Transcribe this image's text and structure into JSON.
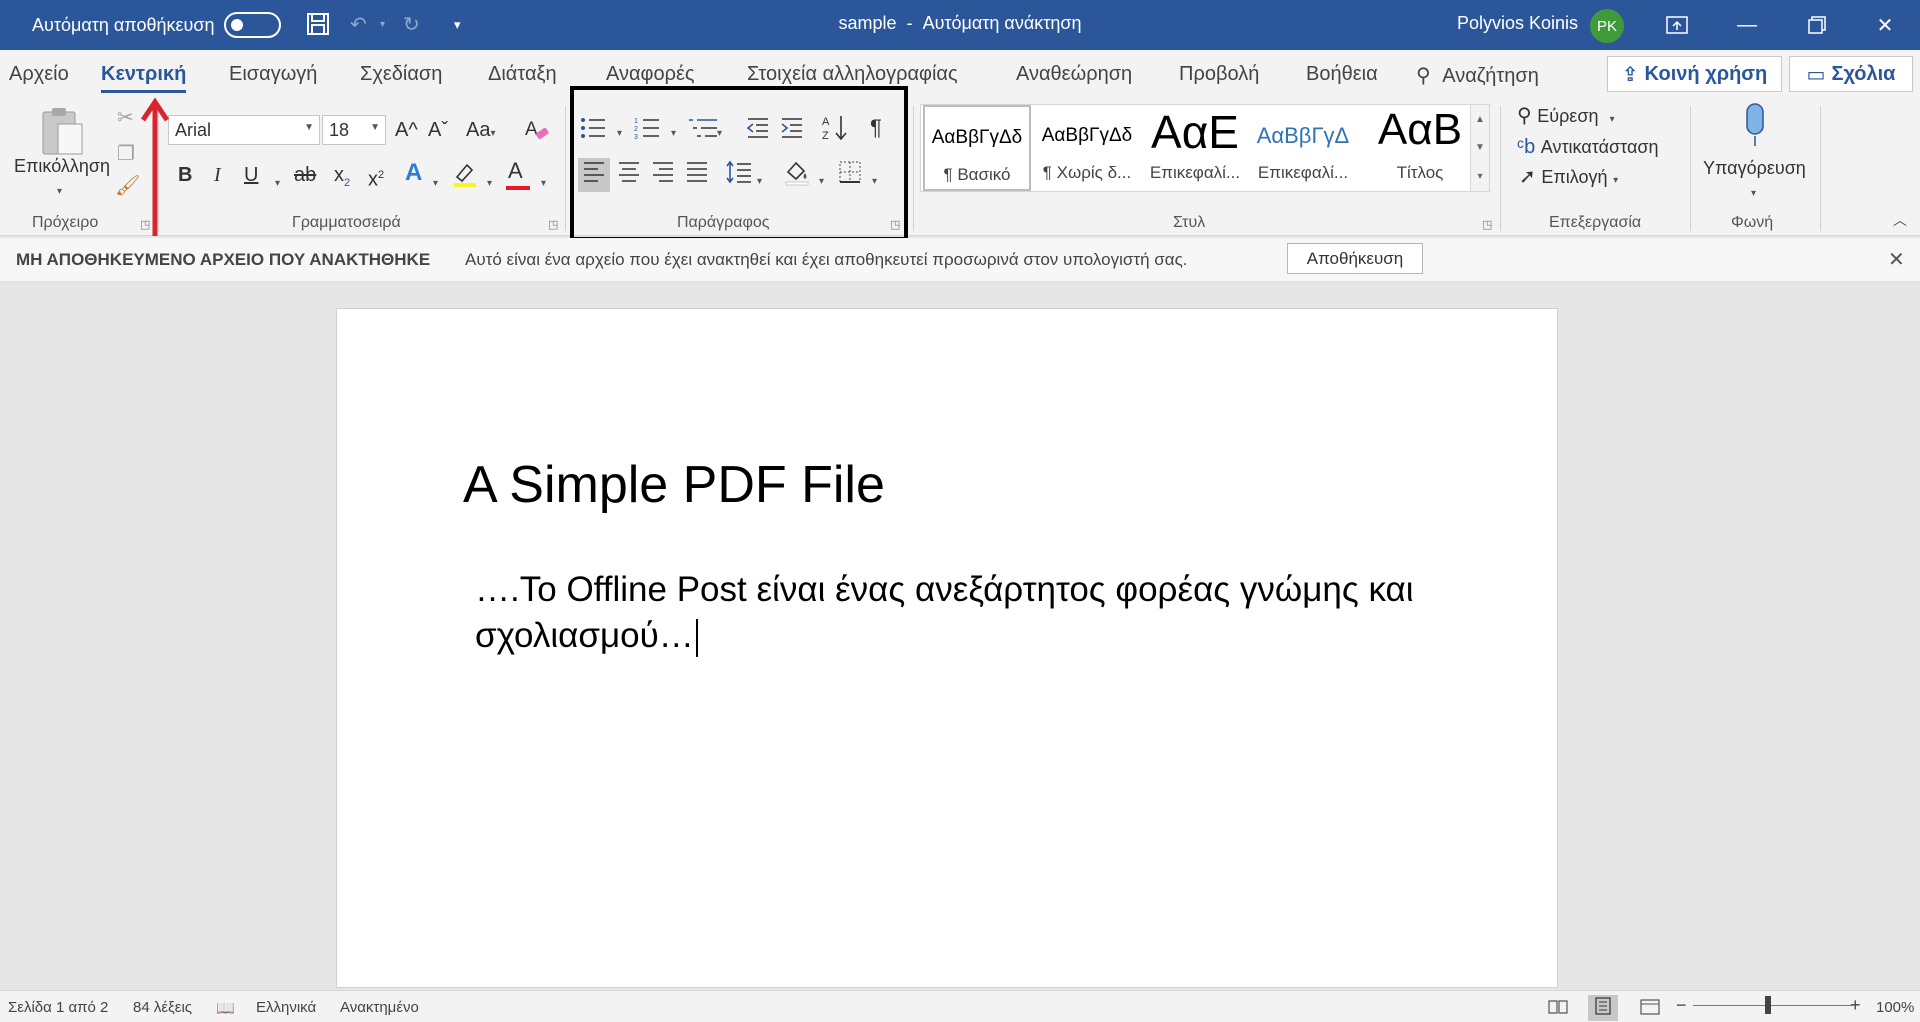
{
  "titlebar": {
    "autosave_label": "Αυτόματη αποθήκευση",
    "doc_name": "sample",
    "separator": "-",
    "recovery_status": "Αυτόματη ανάκτηση",
    "user_name": "Polyvios Koinis",
    "user_initials": "PK",
    "accent_color": "#2b579a",
    "avatar_color": "#3f9b3a"
  },
  "tabs": [
    "Αρχείο",
    "Κεντρική",
    "Εισαγωγή",
    "Σχεδίαση",
    "Διάταξη",
    "Αναφορές",
    "Στοιχεία αλληλογραφίας",
    "Αναθεώρηση",
    "Προβολή",
    "Βοήθεια"
  ],
  "active_tab": "Κεντρική",
  "search_label": "Αναζήτηση",
  "share_label": "Κοινή χρήση",
  "comments_label": "Σχόλια",
  "ribbon": {
    "clipboard": {
      "paste_label": "Επικόλληση",
      "group_label": "Πρόχειρο"
    },
    "font": {
      "font_name": "Arial",
      "font_size": "18",
      "grow": "A^",
      "shrink": "Aˇ",
      "change_case": "Aa",
      "bold": "B",
      "italic": "I",
      "underline": "U",
      "strike": "ab",
      "subscript": "x",
      "superscript": "x",
      "font_color_letter": "A",
      "group_label": "Γραμματοσειρά"
    },
    "paragraph": {
      "group_label": "Παράγραφος",
      "pilcrow": "¶"
    },
    "styles": {
      "group_label": "Στυλ",
      "items": [
        {
          "preview": "ΑαΒβΓγΔδ",
          "name": "¶ Βασικό"
        },
        {
          "preview": "ΑαΒβΓγΔδ",
          "name": "¶ Χωρίς δ..."
        },
        {
          "preview": "ΑαΕ",
          "name": "Επικεφαλί..."
        },
        {
          "preview": "ΑαΒβΓγΔ",
          "name": "Επικεφαλί..."
        },
        {
          "preview": "ΑαΒ",
          "name": "Τίτλος"
        }
      ]
    },
    "editing": {
      "group_label": "Επεξεργασία",
      "find": "Εύρεση",
      "replace": "Αντικατάσταση",
      "select": "Επιλογή"
    },
    "voice": {
      "group_label": "Φωνή",
      "dictate": "Υπαγόρευση"
    }
  },
  "message_bar": {
    "title": "ΜΗ ΑΠΟΘΗΚΕΥΜΕΝΟ ΑΡΧΕΙΟ ΠΟΥ ΑΝΑΚΤΗΘΗΚΕ",
    "text": "Αυτό είναι ένα αρχείο που έχει ανακτηθεί και έχει αποθηκευτεί προσωρινά στον υπολογιστή σας.",
    "save_label": "Αποθήκευση"
  },
  "document": {
    "title": "A Simple PDF File",
    "body": "….Το Offline Post είναι ένας ανεξάρτητος φορέας γνώμης και σχολιασμού…"
  },
  "statusbar": {
    "page": "Σελίδα 1 από 2",
    "words": "84 λέξεις",
    "language": "Ελληνικά",
    "state": "Ανακτημένο",
    "zoom": "100%"
  }
}
